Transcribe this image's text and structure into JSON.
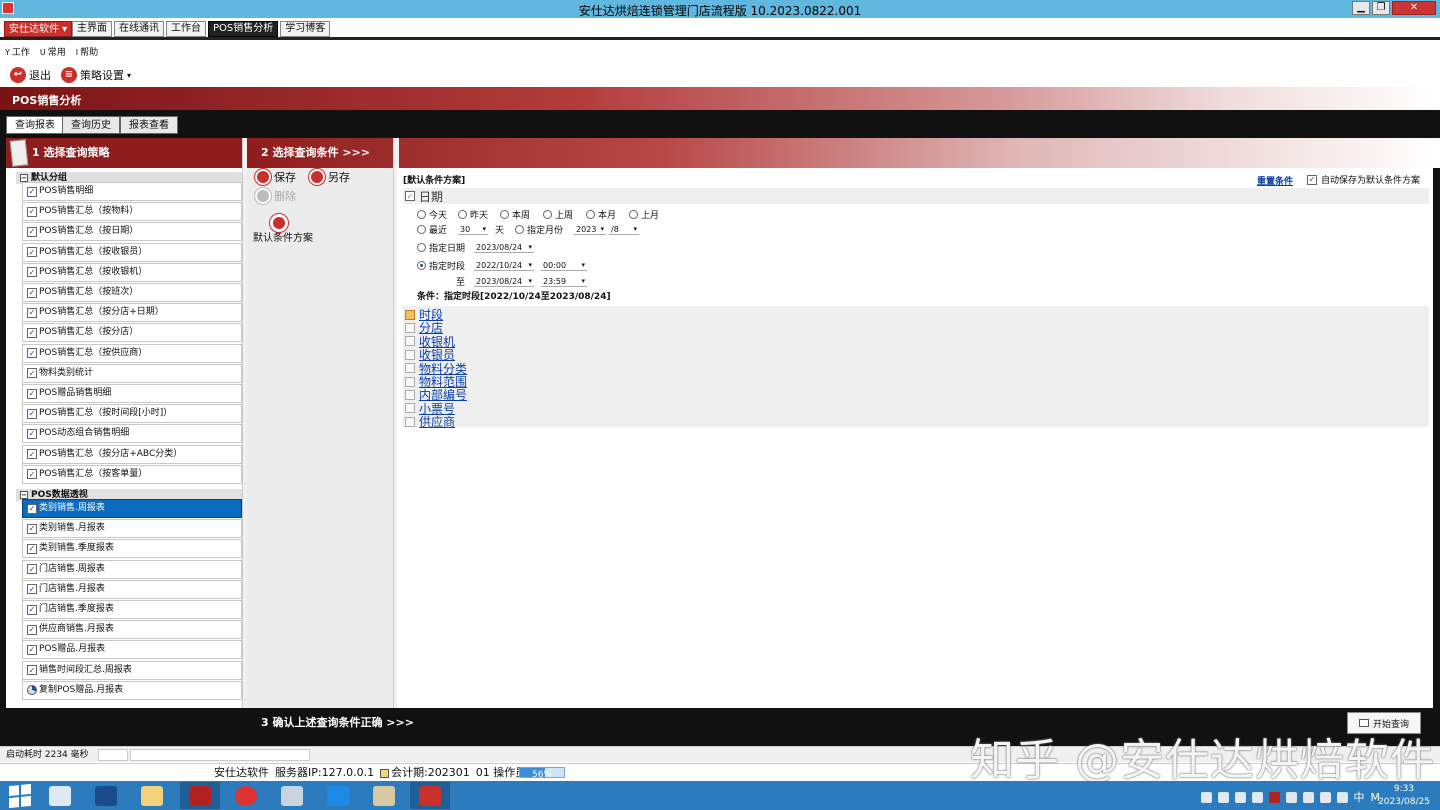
{
  "window": {
    "title": "安仕达烘焙连锁管理门店流程版  10.2023.0822.001",
    "btn_minimize": "▁",
    "btn_restore": "❐",
    "btn_close": "✕"
  },
  "modbar": {
    "brand": "安仕达软件 ▾",
    "tabs": [
      "主界面",
      "在线通讯",
      "工作台",
      "POS销售分析",
      "学习博客"
    ],
    "active_tab": "POS销售分析"
  },
  "menubar": {
    "items": [
      {
        "acc": "Y",
        "label": "工作"
      },
      {
        "acc": "U",
        "label": "常用"
      },
      {
        "acc": "I",
        "label": "帮助"
      }
    ]
  },
  "toolbar": {
    "exit": "退出",
    "strategy": "策略设置",
    "strategy_caret": "▾"
  },
  "page": {
    "title": "POS销售分析"
  },
  "subtabs": [
    "查询报表",
    "查询历史",
    "报表查看"
  ],
  "left": {
    "header": "1  选择查询策略",
    "group1": "默认分组",
    "group1_items": [
      "POS销售明细",
      "POS销售汇总（按物料）",
      "POS销售汇总（按日期）",
      "POS销售汇总（按收银员）",
      "POS销售汇总（按收银机）",
      "POS销售汇总（按班次）",
      "POS销售汇总（按分店+日期）",
      "POS销售汇总（按分店）",
      "POS销售汇总（按供应商）",
      "物料类别统计",
      "POS赠品销售明细",
      "POS销售汇总（按时间段[小时]）",
      "POS动态组合销售明细",
      "POS销售汇总（按分店+ABC分类）",
      "POS销售汇总（按客单量）"
    ],
    "group2": "POS数据透视",
    "group2_items": [
      "类别销售.周报表",
      "类别销售.月报表",
      "类别销售.季度报表",
      "门店销售.周报表",
      "门店销售.月报表",
      "门店销售.季度报表",
      "供应商销售.月报表",
      "POS赠品.月报表",
      "销售时间段汇总.周报表",
      "复制POS赠品.月报表"
    ],
    "selected": "类别销售.周报表",
    "check_mark": "✓"
  },
  "right": {
    "header": "2  选择查询条件  >>>",
    "save": "保存",
    "save_as": "另存",
    "delete": "删除",
    "default_plan": "默认条件方案",
    "plan_title": "[默认条件方案]",
    "reset": "重置条件",
    "autosave_label": "自动保存为默认条件方案",
    "date_section": "日期",
    "quick_ranges": [
      "今天",
      "昨天",
      "本周",
      "上周",
      "本月",
      "上月"
    ],
    "recent_label": "最近",
    "recent_value": "30",
    "recent_unit": "天",
    "month_label": "指定月份",
    "month_year": "2023",
    "month_value": "/8",
    "date_label": "指定日期",
    "date_value": "2023/08/24",
    "period_label": "指定时段",
    "period_from_date": "2022/10/24",
    "period_from_time": "00:00",
    "to_label": "至",
    "period_to_date": "2023/08/24",
    "period_to_time": "23:59",
    "selected_mode": "指定时段",
    "summary": "条件：指定时段[2022/10/24至2023/08/24]",
    "filters": [
      "时段",
      "分店",
      "收银机",
      "收银员",
      "物料分类",
      "物料范围",
      "内部编号",
      "小票号",
      "供应商"
    ],
    "caret": "▾"
  },
  "bottom": {
    "confirm": "3  确认上述查询条件正确  >>>",
    "start": "开始查询"
  },
  "status": {
    "startup": "启动耗时 2234 毫秒",
    "company": "安仕达软件",
    "server": "服务器IP:127.0.0.1",
    "period": "会计期:202301",
    "operator": "01 操作员",
    "progress_pct": 0.56,
    "progress_label": "56%"
  },
  "watermark": "知乎 @安仕达烘焙软件",
  "taskbar": {
    "tray_text": [
      "中",
      "M"
    ],
    "time": "9:33",
    "date": "2023/08/25"
  }
}
